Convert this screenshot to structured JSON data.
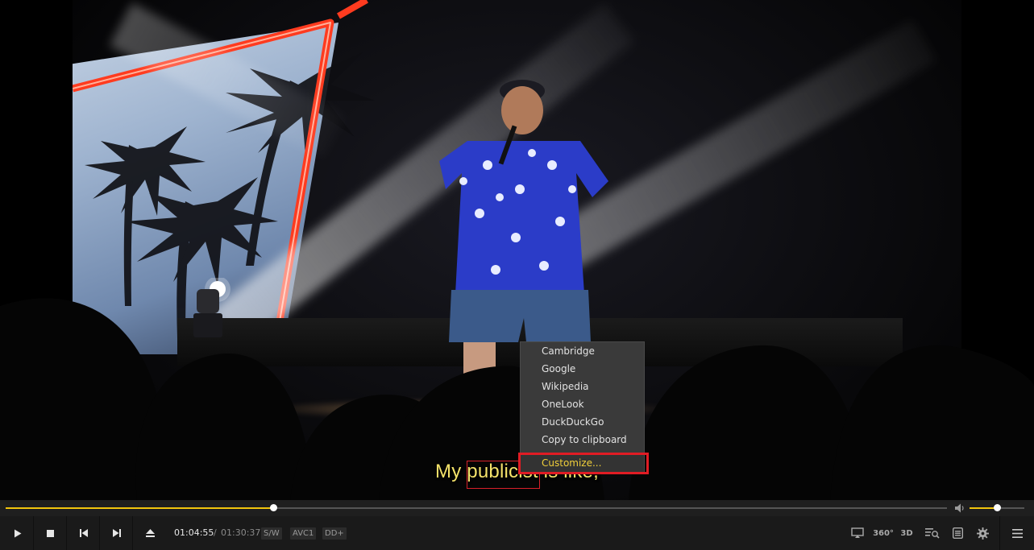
{
  "video": {
    "subtitle_before": "My ",
    "subtitle_word": "publicist",
    "subtitle_after": " is like,"
  },
  "context_menu": {
    "items": [
      "Cambridge",
      "Google",
      "Wikipedia",
      "OneLook",
      "DuckDuckGo",
      "Copy to clipboard"
    ],
    "customize": "Customize..."
  },
  "seek": {
    "progress": 0.284
  },
  "volume": {
    "level": 0.5
  },
  "controls": {
    "current_time": "01:04:55",
    "separator": "/",
    "total_time": "01:30:37",
    "badges": [
      "S/W",
      "AVC1",
      "DD+"
    ],
    "right_labels": {
      "vr": "360°",
      "three_d": "3D"
    }
  },
  "colors": {
    "accent": "#f2c40c",
    "subtitle": "#f4e26a",
    "highlight": "#e01c24"
  }
}
